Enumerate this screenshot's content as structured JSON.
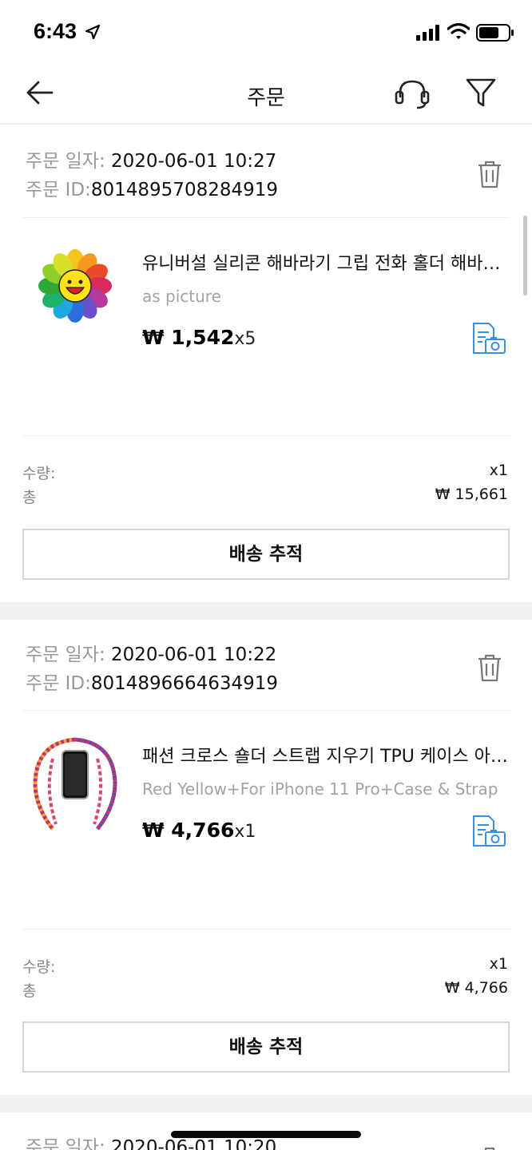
{
  "status_bar": {
    "time": "6:43"
  },
  "header": {
    "title": "주문"
  },
  "order_labels": {
    "date_label": "주문 일자: ",
    "id_label": "주문 ID:",
    "qty_label": "수량:",
    "total_label": "총",
    "track_button": "배송 추적"
  },
  "orders": [
    {
      "date": "2020-06-01 10:27",
      "id": "8014895708284919",
      "product_title": "유니버설 실리콘 해바라기 그립 전화 홀더 해바라기 스탠드",
      "variant": "as picture",
      "price": "₩ 1,542",
      "quantity_mult": "x5",
      "qty_value": "x1",
      "total_value": "₩ 15,661"
    },
    {
      "date": "2020-06-01 10:22",
      "id": "8014896664634919",
      "product_title": "패션 크로스 숄더 스트랩 지우기 TPU 케이스 아이폰",
      "variant": "Red Yellow+For iPhone 11 Pro+Case & Strap",
      "price": "₩ 4,766",
      "quantity_mult": "x1",
      "qty_value": "x1",
      "total_value": "₩ 4,766"
    },
    {
      "date": "2020-06-01 10:20"
    }
  ],
  "icons": {
    "back": "arrow-left-icon",
    "support": "headset-icon",
    "filter": "funnel-icon",
    "delete": "trash-icon",
    "review": "photo-review-icon"
  },
  "colors": {
    "accent_blue": "#3d8fe0",
    "label_gray": "#999999"
  }
}
